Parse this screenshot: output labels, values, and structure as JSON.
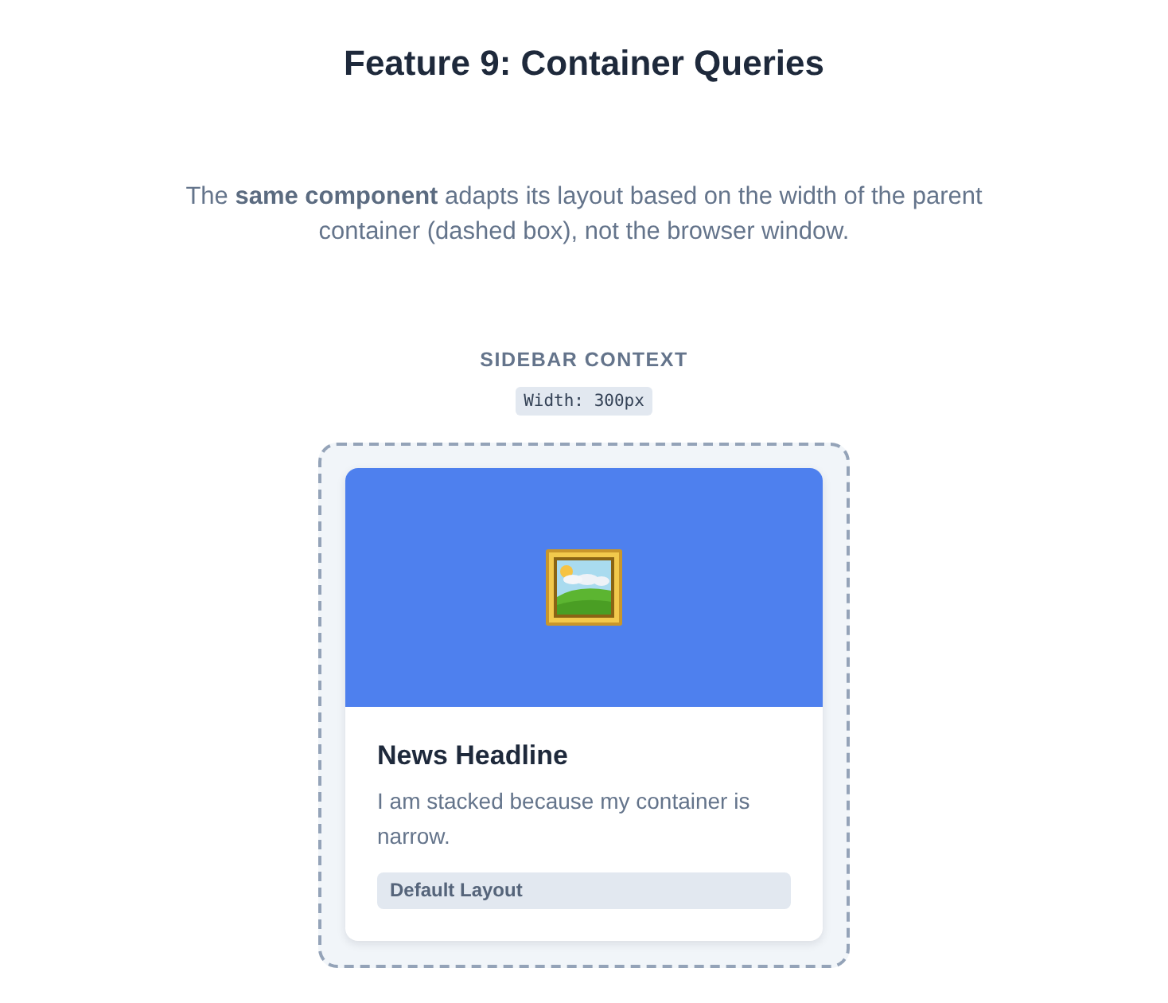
{
  "page": {
    "title": "Feature 9: Container Queries",
    "description": "The **same component** adapts its layout based on the width of the parent container (dashed box), not the browser window."
  },
  "demo": {
    "context_label": "SIDEBAR CONTEXT",
    "width_label": "Width: 300px",
    "card": {
      "headline": "News Headline",
      "text": "I am stacked because my container is narrow.",
      "layout_badge": "Default Layout"
    }
  }
}
